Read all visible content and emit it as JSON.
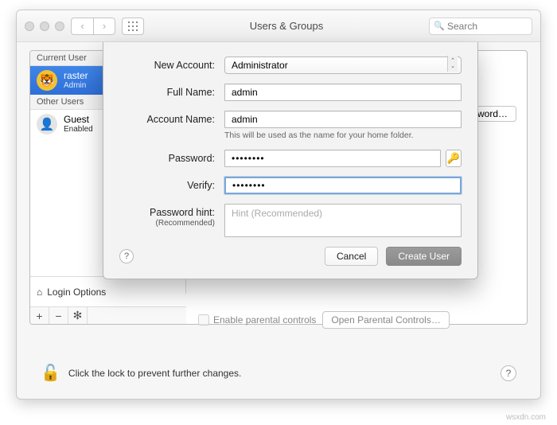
{
  "window": {
    "title": "Users & Groups",
    "search_placeholder": "Search"
  },
  "sidebar": {
    "current_header": "Current User",
    "other_header": "Other Users",
    "users": [
      {
        "name": "raster",
        "role": "Admin",
        "selected": true
      },
      {
        "name": "Guest",
        "role": "Enabled",
        "selected": false
      }
    ],
    "login_options": "Login Options"
  },
  "main": {
    "change_password": "Change Password…",
    "enable_parental": "Enable parental controls",
    "open_parental": "Open Parental Controls…"
  },
  "lock_message": "Click the lock to prevent further changes.",
  "sheet": {
    "labels": {
      "new_account": "New Account:",
      "full_name": "Full Name:",
      "account_name": "Account Name:",
      "password": "Password:",
      "verify": "Verify:",
      "hint": "Password hint:",
      "hint_sub": "(Recommended)"
    },
    "values": {
      "account_type": "Administrator",
      "full_name": "admin",
      "account_name": "admin",
      "account_name_help": "This will be used as the name for your home folder.",
      "hint_placeholder": "Hint (Recommended)"
    },
    "buttons": {
      "cancel": "Cancel",
      "create": "Create User"
    }
  },
  "watermark": "wsxdn.com"
}
